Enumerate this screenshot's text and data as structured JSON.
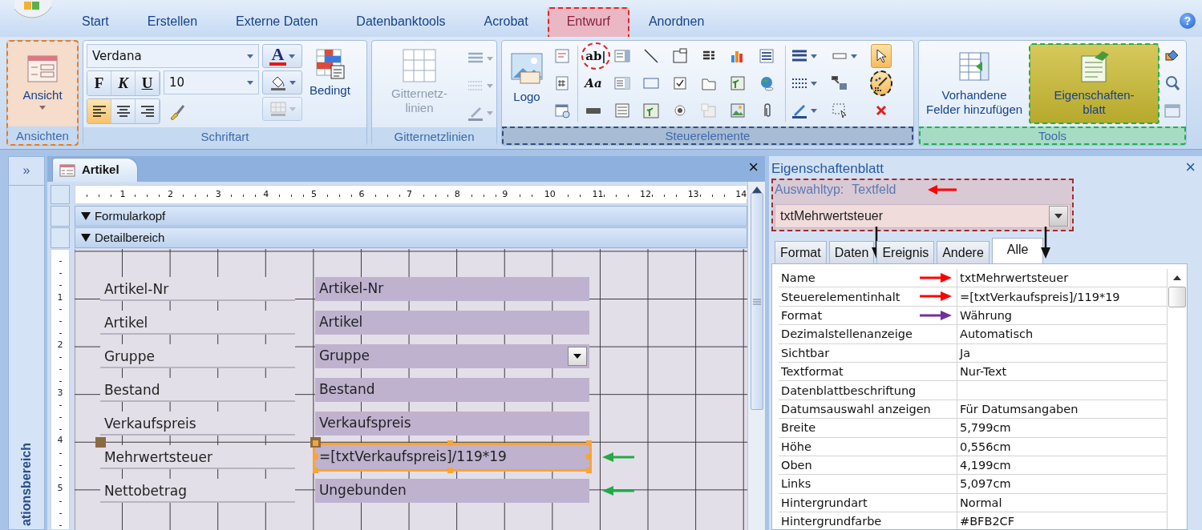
{
  "tabs": [
    {
      "label": "Start",
      "selected": false
    },
    {
      "label": "Erstellen",
      "selected": false
    },
    {
      "label": "Externe Daten",
      "selected": false
    },
    {
      "label": "Datenbanktools",
      "selected": false
    },
    {
      "label": "Acrobat",
      "selected": false
    },
    {
      "label": "Entwurf",
      "selected": true
    },
    {
      "label": "Anordnen",
      "selected": false
    }
  ],
  "help_button": "?",
  "ribbon": {
    "groups": [
      {
        "kind": "views",
        "label": "Ansichten",
        "highlighted": true,
        "view_button": {
          "label": "Ansicht"
        }
      },
      {
        "kind": "font",
        "label": "Schriftart",
        "highlighted": false,
        "font_name": "Verdana",
        "font_size": "10",
        "style_buttons": [
          "F",
          "K",
          "U"
        ],
        "align_buttons": [
          {
            "selected": true
          },
          {
            "selected": false
          },
          {
            "selected": false
          }
        ],
        "font_color_button": "A",
        "conditional_button": "Bedingt"
      },
      {
        "kind": "gridlines",
        "label": "Gitternetzlinien",
        "highlighted": false,
        "gridlines_button": {
          "lines": [
            "Gitternetz-",
            "linien"
          ],
          "disabled": true
        }
      },
      {
        "kind": "controls",
        "label": "Steuerelemente",
        "highlighted": true,
        "logo_button": "Logo",
        "textbox_tool": {
          "label": "ab|",
          "highlighted": true
        },
        "label_tool": "Aa",
        "select_tool": {
          "selected": true
        },
        "wizard_tool": {
          "on": true,
          "highlighted": true
        }
      },
      {
        "kind": "tools",
        "label": "Tools",
        "highlighted": true,
        "add_fields_button": {
          "lines": [
            "Vorhandene",
            "Felder hinzufügen"
          ]
        },
        "property_sheet_button": {
          "lines": [
            "Eigenschaften-",
            "blatt"
          ],
          "selected": true,
          "highlighted": true
        }
      }
    ]
  },
  "nav_pane": {
    "expand_button": "»",
    "title": "ationsbereich"
  },
  "document": {
    "tab": "Artikel",
    "close_button": "×",
    "ruler_marks": [
      "1",
      "2",
      "3",
      "4",
      "5",
      "6",
      "7",
      "8",
      "9",
      "10",
      "11",
      "12",
      "13",
      "14"
    ],
    "side_ruler_marks": [
      "1",
      "2",
      "3",
      "4",
      "5"
    ],
    "sections": [
      "Formularkopf",
      "Detailbereich"
    ],
    "fields": [
      {
        "label": "Artikel-Nr",
        "control": "Artikel-Nr",
        "kind": "textbox",
        "selected": false,
        "arrow": false
      },
      {
        "label": "Artikel",
        "control": "Artikel",
        "kind": "textbox",
        "selected": false,
        "arrow": false
      },
      {
        "label": "Gruppe",
        "control": "Gruppe",
        "kind": "combobox",
        "selected": false,
        "arrow": false
      },
      {
        "label": "Bestand",
        "control": "Bestand",
        "kind": "textbox",
        "selected": false,
        "arrow": false
      },
      {
        "label": "Verkaufspreis",
        "control": "Verkaufspreis",
        "kind": "textbox",
        "selected": false,
        "arrow": false
      },
      {
        "label": "Mehrwertsteuer",
        "control": "=[txtVerkaufspreis]/119*19",
        "kind": "textbox",
        "selected": true,
        "arrow": true
      },
      {
        "label": "Nettobetrag",
        "control": "Ungebunden",
        "kind": "textbox",
        "selected": false,
        "arrow": true
      }
    ]
  },
  "property_sheet": {
    "title": "Eigenschaftenblatt",
    "close_button": "×",
    "highlighted": true,
    "selection_type_label": "Auswahltyp:",
    "selection_type": "Textfeld",
    "selection_arrow": true,
    "object": "txtMehrwertsteuer",
    "tabs": [
      {
        "label": "Format",
        "selected": false,
        "arrow": false
      },
      {
        "label": "Daten",
        "selected": false,
        "arrow": true
      },
      {
        "label": "Ereignis",
        "selected": false,
        "arrow": false
      },
      {
        "label": "Andere",
        "selected": false,
        "arrow": false
      },
      {
        "label": "Alle",
        "selected": true,
        "arrow": true
      }
    ],
    "rows": [
      {
        "name": "Name",
        "value": "txtMehrwertsteuer",
        "color": "#ff0000"
      },
      {
        "name": "Steuerelementinhalt",
        "value": "=[txtVerkaufspreis]/119*19",
        "color": "#ff0000"
      },
      {
        "name": "Format",
        "value": "Währung",
        "color": "#7030a0"
      },
      {
        "name": "Dezimalstellenanzeige",
        "value": "Automatisch"
      },
      {
        "name": "Sichtbar",
        "value": "Ja"
      },
      {
        "name": "Textformat",
        "value": "Nur-Text"
      },
      {
        "name": "Datenblattbeschriftung"
      },
      {
        "name": "Datumsauswahl anzeigen",
        "value": "Für Datumsangaben"
      },
      {
        "name": "Breite",
        "value": "5,799cm"
      },
      {
        "name": "Höhe",
        "value": "0,556cm"
      },
      {
        "name": "Oben",
        "value": "4,199cm"
      },
      {
        "name": "Links",
        "value": "5,097cm"
      },
      {
        "name": "Hintergrundart",
        "value": "Normal"
      },
      {
        "name": "Hintergrundfarbe",
        "value": "#BFB2CF"
      }
    ]
  }
}
